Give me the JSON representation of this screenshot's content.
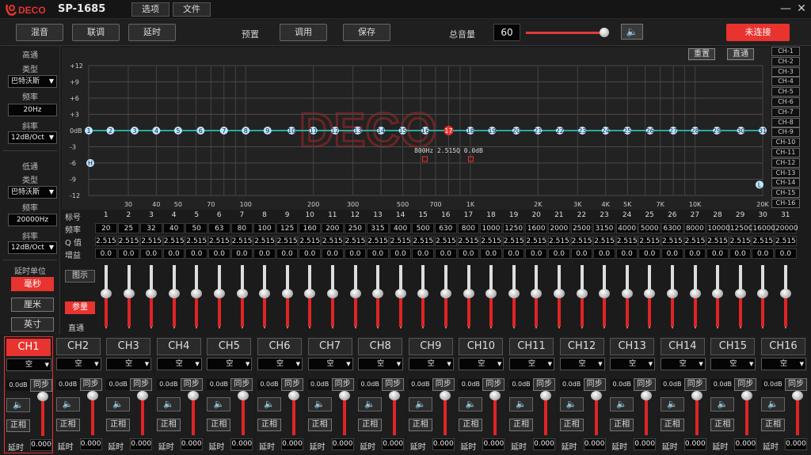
{
  "app": {
    "model": "SP-1685",
    "menu": [
      "选项",
      "文件"
    ]
  },
  "toolbar": {
    "mix_label": "混音",
    "link_label": "联调",
    "delay_label": "延时",
    "preset_label": "预置",
    "recall_label": "调用",
    "save_label": "保存",
    "master_volume_label": "总音量",
    "master_volume_value": "60",
    "master_volume_level": 0.97,
    "connect_label": "未连接"
  },
  "highpass": {
    "title": "高通",
    "type_label": "类型",
    "type_value": "巴特沃斯",
    "freq_label": "频率",
    "freq_value": "20Hz",
    "slope_label": "斜率",
    "slope_value": "12dB/Oct"
  },
  "lowpass": {
    "title": "低通",
    "type_label": "类型",
    "type_value": "巴特沃斯",
    "freq_label": "频率",
    "freq_value": "20000Hz",
    "slope_label": "斜率",
    "slope_value": "12dB/Oct"
  },
  "delay_unit": {
    "title": "延时单位",
    "options": [
      "毫秒",
      "厘米",
      "英寸"
    ],
    "selected": "毫秒"
  },
  "graph": {
    "reset_label": "重置",
    "bypass_label": "直通",
    "y_ticks": [
      "+12",
      "+9",
      "+6",
      "+3",
      "0dB",
      "-3",
      "-6",
      "-9",
      "-12"
    ],
    "x_ticks_top": [
      "30",
      "40",
      "50",
      "70",
      "100",
      "200",
      "300",
      "500",
      "700",
      "1K"
    ],
    "x_ticks_bottom": [
      "2K",
      "3K",
      "4K",
      "5K",
      "7K",
      "10K",
      "20K"
    ],
    "selected_band": "17",
    "selected_info": "800Hz  2.515Q  0.0dB",
    "hp_marker": "H",
    "lp_marker": "L"
  },
  "ch_list": [
    "CH-1",
    "CH-2",
    "CH-3",
    "CH-4",
    "CH-5",
    "CH-6",
    "CH-7",
    "CH-8",
    "CH-9",
    "CH-10",
    "CH-11",
    "CH-12",
    "CH-13",
    "CH-14",
    "CH-15",
    "CH-16"
  ],
  "table": {
    "row_labels": [
      "标号",
      "频率",
      "Q 值",
      "增益"
    ],
    "index": [
      "1",
      "2",
      "3",
      "4",
      "5",
      "6",
      "7",
      "8",
      "9",
      "10",
      "11",
      "12",
      "13",
      "14",
      "15",
      "16",
      "17",
      "18",
      "19",
      "20",
      "21",
      "22",
      "23",
      "24",
      "25",
      "26",
      "27",
      "28",
      "29",
      "30",
      "31"
    ],
    "freq": [
      "20",
      "25",
      "32",
      "40",
      "50",
      "63",
      "80",
      "100",
      "125",
      "160",
      "200",
      "250",
      "315",
      "400",
      "500",
      "630",
      "800",
      "1000",
      "1250",
      "1600",
      "2000",
      "2500",
      "3150",
      "4000",
      "5000",
      "6300",
      "8000",
      "10000",
      "12500",
      "16000",
      "20000"
    ],
    "q": [
      "2.515",
      "2.515",
      "2.515",
      "2.515",
      "2.515",
      "2.515",
      "2.515",
      "2.515",
      "2.515",
      "2.515",
      "2.515",
      "2.515",
      "2.515",
      "2.515",
      "2.515",
      "2.515",
      "2.515",
      "2.515",
      "2.515",
      "2.515",
      "2.515",
      "2.515",
      "2.515",
      "2.515",
      "2.515",
      "2.515",
      "2.515",
      "2.515",
      "2.515",
      "2.515",
      "2.515"
    ],
    "gain": [
      "0.0",
      "0.0",
      "0.0",
      "0.0",
      "0.0",
      "0.0",
      "0.0",
      "0.0",
      "0.0",
      "0.0",
      "0.0",
      "0.0",
      "0.0",
      "0.0",
      "0.0",
      "0.0",
      "0.0",
      "0.0",
      "0.0",
      "0.0",
      "0.0",
      "0.0",
      "0.0",
      "0.0",
      "0.0",
      "0.0",
      "0.0",
      "0.0",
      "0.0",
      "0.0",
      "0.0"
    ]
  },
  "fader_side": {
    "graph_label": "图示",
    "param_label": "参量",
    "bypass_label": "直通"
  },
  "channels": [
    {
      "name": "CH1",
      "source": "空",
      "gain": "0.0dB",
      "sync": "同步",
      "phase": "正相",
      "delay_label": "延时",
      "delay": "0.000"
    },
    {
      "name": "CH2",
      "source": "空",
      "gain": "0.0dB",
      "sync": "同步",
      "phase": "正相",
      "delay_label": "延时",
      "delay": "0.000"
    },
    {
      "name": "CH3",
      "source": "空",
      "gain": "0.0dB",
      "sync": "同步",
      "phase": "正相",
      "delay_label": "延时",
      "delay": "0.000"
    },
    {
      "name": "CH4",
      "source": "空",
      "gain": "0.0dB",
      "sync": "同步",
      "phase": "正相",
      "delay_label": "延时",
      "delay": "0.000"
    },
    {
      "name": "CH5",
      "source": "空",
      "gain": "0.0dB",
      "sync": "同步",
      "phase": "正相",
      "delay_label": "延时",
      "delay": "0.000"
    },
    {
      "name": "CH6",
      "source": "空",
      "gain": "0.0dB",
      "sync": "同步",
      "phase": "正相",
      "delay_label": "延时",
      "delay": "0.000"
    },
    {
      "name": "CH7",
      "source": "空",
      "gain": "0.0dB",
      "sync": "同步",
      "phase": "正相",
      "delay_label": "延时",
      "delay": "0.000"
    },
    {
      "name": "CH8",
      "source": "空",
      "gain": "0.0dB",
      "sync": "同步",
      "phase": "正相",
      "delay_label": "延时",
      "delay": "0.000"
    },
    {
      "name": "CH9",
      "source": "空",
      "gain": "0.0dB",
      "sync": "同步",
      "phase": "正相",
      "delay_label": "延时",
      "delay": "0.000"
    },
    {
      "name": "CH10",
      "source": "空",
      "gain": "0.0dB",
      "sync": "同步",
      "phase": "正相",
      "delay_label": "延时",
      "delay": "0.000"
    },
    {
      "name": "CH11",
      "source": "空",
      "gain": "0.0dB",
      "sync": "同步",
      "phase": "正相",
      "delay_label": "延时",
      "delay": "0.000"
    },
    {
      "name": "CH12",
      "source": "空",
      "gain": "0.0dB",
      "sync": "同步",
      "phase": "正相",
      "delay_label": "延时",
      "delay": "0.000"
    },
    {
      "name": "CH13",
      "source": "空",
      "gain": "0.0dB",
      "sync": "同步",
      "phase": "正相",
      "delay_label": "延时",
      "delay": "0.000"
    },
    {
      "name": "CH14",
      "source": "空",
      "gain": "0.0dB",
      "sync": "同步",
      "phase": "正相",
      "delay_label": "延时",
      "delay": "0.000"
    },
    {
      "name": "CH15",
      "source": "空",
      "gain": "0.0dB",
      "sync": "同步",
      "phase": "正相",
      "delay_label": "延时",
      "delay": "0.000"
    },
    {
      "name": "CH16",
      "source": "空",
      "gain": "0.0dB",
      "sync": "同步",
      "phase": "正相",
      "delay_label": "延时",
      "delay": "0.000"
    }
  ],
  "active_channel": "CH1",
  "colors": {
    "accent_red": "#e8332f",
    "eq_line": "#2aa9a0",
    "band_point": "#bfe6ff",
    "selected_point": "#e8332f"
  },
  "icons": {
    "speaker": "speaker-icon",
    "minimize": "minimize-icon",
    "close": "close-icon"
  }
}
